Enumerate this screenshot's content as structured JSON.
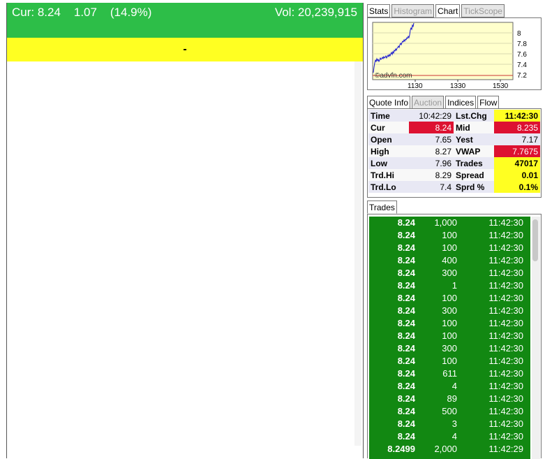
{
  "header": {
    "cur_label": "Cur: 8.24",
    "change": "1.07",
    "change_pct": "(14.9%)",
    "volume": "Vol: 20,239,915"
  },
  "status_bar": {
    "text": "-"
  },
  "chart_tabs": [
    "Stats",
    "Histogram",
    "Chart",
    "TickScope"
  ],
  "chart": {
    "watermark": "©advfn.com",
    "x_ticks": [
      "1130",
      "1330",
      "1530"
    ],
    "y_ticks": [
      "8",
      "7.8",
      "7.6",
      "7.4",
      "7.2"
    ],
    "colors": {
      "background": "#ffffcc",
      "line": "#1010d0",
      "prev_close": "#cc3333"
    }
  },
  "quote_tabs": [
    "Quote Info",
    "Auction",
    "Indices",
    "Flow"
  ],
  "quote": [
    {
      "l1": "Time",
      "v1": "10:42:29",
      "l2": "Lst.Chg",
      "v2": "11:42:30"
    },
    {
      "l1": "Cur",
      "v1": "8.24",
      "l2": "Mid",
      "v2": "8.235"
    },
    {
      "l1": "Open",
      "v1": "7.65",
      "l2": "Yest",
      "v2": "7.17"
    },
    {
      "l1": "High",
      "v1": "8.27",
      "l2": "VWAP",
      "v2": "7.7675"
    },
    {
      "l1": "Low",
      "v1": "7.96",
      "l2": "Trades",
      "v2": "47017"
    },
    {
      "l1": "Trd.Hi",
      "v1": "8.29",
      "l2": "Spread",
      "v2": "0.01"
    },
    {
      "l1": "Trd.Lo",
      "v1": "7.4",
      "l2": "Sprd %",
      "v2": "0.1%"
    }
  ],
  "trades_tabs": [
    "Trades"
  ],
  "trades": [
    {
      "price": "8.24",
      "qty": "1,000",
      "time": "11:42:30"
    },
    {
      "price": "8.24",
      "qty": "100",
      "time": "11:42:30"
    },
    {
      "price": "8.24",
      "qty": "100",
      "time": "11:42:30"
    },
    {
      "price": "8.24",
      "qty": "400",
      "time": "11:42:30"
    },
    {
      "price": "8.24",
      "qty": "300",
      "time": "11:42:30"
    },
    {
      "price": "8.24",
      "qty": "1",
      "time": "11:42:30"
    },
    {
      "price": "8.24",
      "qty": "100",
      "time": "11:42:30"
    },
    {
      "price": "8.24",
      "qty": "300",
      "time": "11:42:30"
    },
    {
      "price": "8.24",
      "qty": "100",
      "time": "11:42:30"
    },
    {
      "price": "8.24",
      "qty": "100",
      "time": "11:42:30"
    },
    {
      "price": "8.24",
      "qty": "300",
      "time": "11:42:30"
    },
    {
      "price": "8.24",
      "qty": "100",
      "time": "11:42:30"
    },
    {
      "price": "8.24",
      "qty": "611",
      "time": "11:42:30"
    },
    {
      "price": "8.24",
      "qty": "4",
      "time": "11:42:30"
    },
    {
      "price": "8.24",
      "qty": "89",
      "time": "11:42:30"
    },
    {
      "price": "8.24",
      "qty": "500",
      "time": "11:42:30"
    },
    {
      "price": "8.24",
      "qty": "3",
      "time": "11:42:30"
    },
    {
      "price": "8.24",
      "qty": "4",
      "time": "11:42:30"
    },
    {
      "price": "8.2499",
      "qty": "2,000",
      "time": "11:42:29"
    }
  ]
}
